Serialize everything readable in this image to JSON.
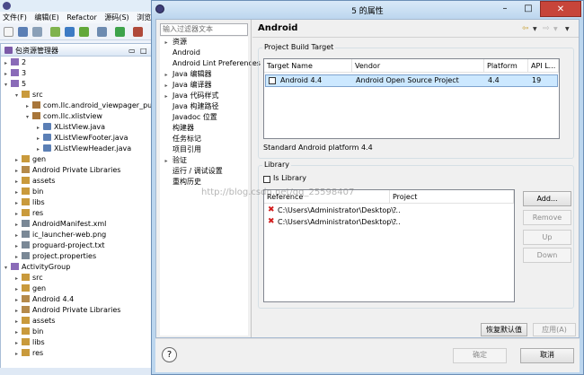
{
  "ide": {
    "menu": [
      "文件(F)",
      "编辑(E)",
      "Refactor",
      "源码(S)",
      "浏览(N)"
    ],
    "package_view_title": "包资源管理器",
    "tree": [
      {
        "label": "2",
        "depth": 0,
        "icon": "project"
      },
      {
        "label": "3",
        "depth": 0,
        "icon": "project"
      },
      {
        "label": "5",
        "depth": 0,
        "icon": "project",
        "open": true
      },
      {
        "label": "src",
        "depth": 1,
        "icon": "folder",
        "open": true
      },
      {
        "label": "com.llc.android_viewpager_pullre",
        "depth": 2,
        "icon": "package"
      },
      {
        "label": "com.llc.xlistview",
        "depth": 2,
        "icon": "package",
        "open": true
      },
      {
        "label": "XListView.java",
        "depth": 3,
        "icon": "java"
      },
      {
        "label": "XListViewFooter.java",
        "depth": 3,
        "icon": "java"
      },
      {
        "label": "XListViewHeader.java",
        "depth": 3,
        "icon": "java"
      },
      {
        "label": "gen",
        "depth": 1,
        "icon": "folder"
      },
      {
        "label": "Android Private Libraries",
        "depth": 1,
        "icon": "library"
      },
      {
        "label": "assets",
        "depth": 1,
        "icon": "folder"
      },
      {
        "label": "bin",
        "depth": 1,
        "icon": "folder"
      },
      {
        "label": "libs",
        "depth": 1,
        "icon": "folder"
      },
      {
        "label": "res",
        "depth": 1,
        "icon": "folder"
      },
      {
        "label": "AndroidManifest.xml",
        "depth": 1,
        "icon": "file"
      },
      {
        "label": "ic_launcher-web.png",
        "depth": 1,
        "icon": "file"
      },
      {
        "label": "proguard-project.txt",
        "depth": 1,
        "icon": "file"
      },
      {
        "label": "project.properties",
        "depth": 1,
        "icon": "file"
      },
      {
        "label": "ActivityGroup",
        "depth": 0,
        "icon": "project",
        "open": true
      },
      {
        "label": "src",
        "depth": 1,
        "icon": "folder"
      },
      {
        "label": "gen",
        "depth": 1,
        "icon": "folder"
      },
      {
        "label": "Android 4.4",
        "depth": 1,
        "icon": "library"
      },
      {
        "label": "Android Private Libraries",
        "depth": 1,
        "icon": "library"
      },
      {
        "label": "assets",
        "depth": 1,
        "icon": "folder"
      },
      {
        "label": "bin",
        "depth": 1,
        "icon": "folder"
      },
      {
        "label": "libs",
        "depth": 1,
        "icon": "folder"
      },
      {
        "label": "res",
        "depth": 1,
        "icon": "folder"
      }
    ]
  },
  "dialog": {
    "title": "5 的属性",
    "filter_placeholder": "输入过滤器文本",
    "nav": [
      {
        "label": "资源",
        "expandable": true
      },
      {
        "label": "Android",
        "expandable": false,
        "selected": true
      },
      {
        "label": "Android Lint Preferences",
        "expandable": false
      },
      {
        "label": "Java 编辑器",
        "expandable": true
      },
      {
        "label": "Java 编译器",
        "expandable": true
      },
      {
        "label": "Java 代码样式",
        "expandable": true
      },
      {
        "label": "Java 构建路径",
        "expandable": false
      },
      {
        "label": "Javadoc 位置",
        "expandable": false
      },
      {
        "label": "构建器",
        "expandable": false
      },
      {
        "label": "任务标记",
        "expandable": false
      },
      {
        "label": "项目引用",
        "expandable": false
      },
      {
        "label": "验证",
        "expandable": true
      },
      {
        "label": "运行 / 调试设置",
        "expandable": false
      },
      {
        "label": "重构历史",
        "expandable": false
      }
    ],
    "page_title": "Android",
    "build_target": {
      "group_label": "Project Build Target",
      "columns": [
        "Target Name",
        "Vendor",
        "Platform",
        "API L..."
      ],
      "rows": [
        {
          "name": "Android 4.4",
          "vendor": "Android Open Source Project",
          "platform": "4.4",
          "api": "19",
          "checked": false,
          "selected": true
        }
      ],
      "description": "Standard Android platform 4.4"
    },
    "library": {
      "group_label": "Library",
      "is_library_label": "Is Library",
      "is_library_checked": false,
      "columns": [
        "Reference",
        "Project"
      ],
      "rows": [
        {
          "reference": "C:\\Users\\Administrator\\Desktop\\...",
          "project": "?"
        },
        {
          "reference": "C:\\Users\\Administrator\\Desktop\\...",
          "project": "?"
        }
      ],
      "buttons": [
        {
          "label": "Add...",
          "enabled": true
        },
        {
          "label": "Remove",
          "enabled": false
        },
        {
          "label": "Up",
          "enabled": false
        },
        {
          "label": "Down",
          "enabled": false
        }
      ]
    },
    "restore_defaults_label": "恢复默认值(D)",
    "apply_label": "应用(A)",
    "ok_label": "确定",
    "cancel_label": "取消",
    "help_symbol": "?",
    "watermark": "http://blog.csdn.net/qq_25598407"
  },
  "colors": {
    "selection": "#cce8ff",
    "error_icon": "#d21d1d",
    "close_button": "#c7453a"
  }
}
